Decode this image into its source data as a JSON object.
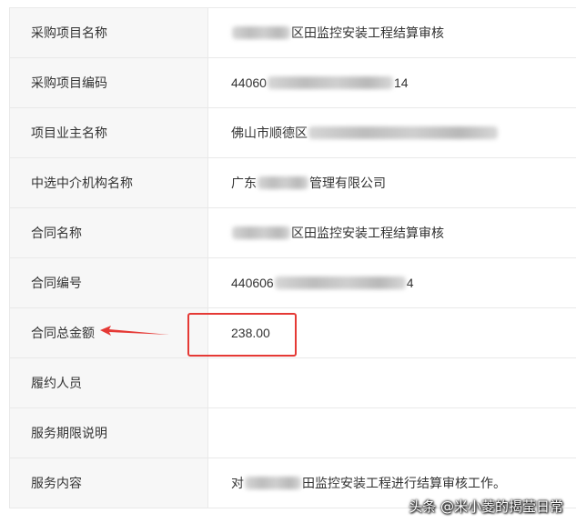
{
  "rows": [
    {
      "label": "采购项目名称",
      "prefix": "",
      "suffix": "区田监控安装工程结算审核",
      "blur_w": 64
    },
    {
      "label": "采购项目编码",
      "prefix": "44060",
      "suffix": "14",
      "blur_w": 138
    },
    {
      "label": "项目业主名称",
      "prefix": "佛山市顺德区",
      "suffix": "",
      "blur_w": 208
    },
    {
      "label": "中选中介机构名称",
      "prefix": "广东",
      "suffix": "管理有限公司",
      "blur_w": 56
    },
    {
      "label": "合同名称",
      "prefix": "",
      "suffix": "区田监控安装工程结算审核",
      "blur_w": 64
    },
    {
      "label": "合同编号",
      "prefix": "440606",
      "suffix": "4",
      "blur_w": 144
    },
    {
      "label": "合同总金额",
      "prefix": "238.00",
      "suffix": "",
      "blur_w": 0
    },
    {
      "label": "履约人员",
      "prefix": "",
      "suffix": "",
      "blur_w": 0
    },
    {
      "label": "服务期限说明",
      "prefix": "",
      "suffix": "",
      "blur_w": 0
    },
    {
      "label": "服务内容",
      "prefix": "对",
      "suffix": "田监控安装工程进行结算审核工作。",
      "blur_w": 62
    }
  ],
  "watermark": "头条 @米小菱的揭莹日常",
  "colors": {
    "highlight": "#e53935",
    "label_bg": "#f7f7f7",
    "border": "#e9e9e9"
  }
}
